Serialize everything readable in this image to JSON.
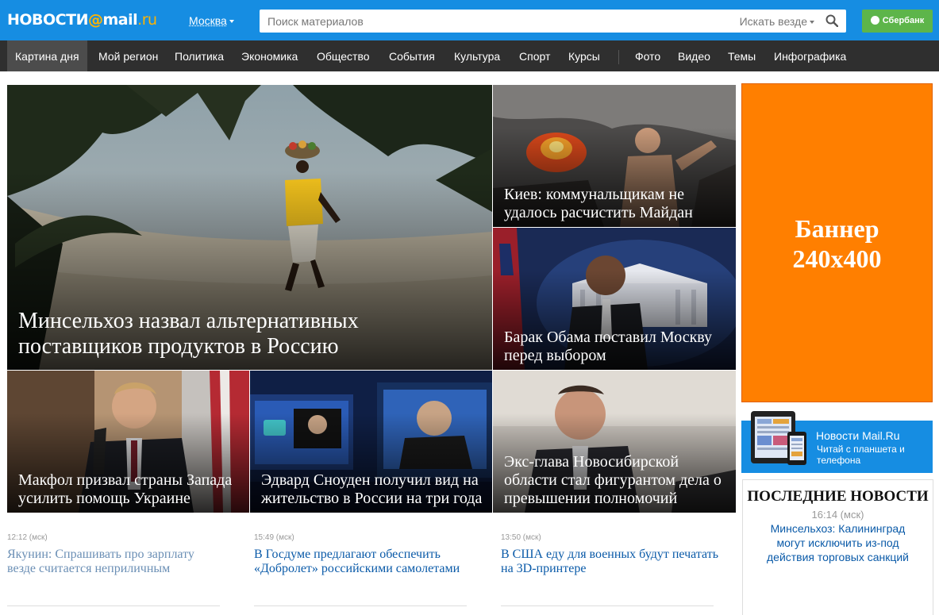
{
  "header": {
    "logo_main": "НОВОСТИ",
    "logo_at": "@",
    "logo_brand": "mail",
    "logo_dom": ".ru",
    "region": "Москва",
    "search_placeholder": "Поиск материалов",
    "search_scope": "Искать везде",
    "sber_label": "Сбербанк"
  },
  "nav": {
    "items": [
      "Картина дня",
      "Мой регион",
      "Политика",
      "Экономика",
      "Общество",
      "События",
      "Культура",
      "Спорт",
      "Курсы",
      "Фото",
      "Видео",
      "Темы",
      "Инфографика"
    ],
    "active": "Картина дня"
  },
  "tiles": {
    "main": "Минсельхоз назвал альтернативных поставщиков продуктов в Россию",
    "kiev": "Киев: коммунальщикам не удалось расчистить Майдан",
    "obama": "Барак Обама поставил Москву перед выбором",
    "mcfaul": "Макфол призвал страны Запада усилить помощь Украине",
    "snowden": "Эдвард Сноуден получил вид на жительство в России на три года",
    "novosib": "Экс-глава Новосибирской области стал фигурантом дела о превышении полномочий"
  },
  "banner": {
    "line1": "Баннер",
    "line2": "240x400"
  },
  "app_promo": {
    "title": "Новости Mail.Ru",
    "subtitle": "Читай с планшета и телефона"
  },
  "latest": {
    "heading": "ПОСЛЕДНИЕ НОВОСТИ",
    "time": "16:14 (мск)",
    "link": "Минсельхоз: Калининград могут исключить из-под действия торговых санкций"
  },
  "news": [
    {
      "time": "12:12 (мск)",
      "title": "Якунин: Спрашивать про зарплату везде считается неприличным"
    },
    {
      "time": "15:49 (мск)",
      "title": "В Госдуме предлагают обеспечить «Добролет» российскими самолетами"
    },
    {
      "time": "13:50 (мск)",
      "title": "В США еду для военных будут печатать на 3D-принтере"
    }
  ],
  "colors": {
    "header_blue": "#168de2",
    "nav_dark": "#2f2f2f",
    "logo_accent": "#ffb300",
    "banner_orange": "#ff7f00",
    "sber_green": "#5db54a",
    "link_blue": "#0a5aa8",
    "link_visited": "#6b8fb5"
  }
}
